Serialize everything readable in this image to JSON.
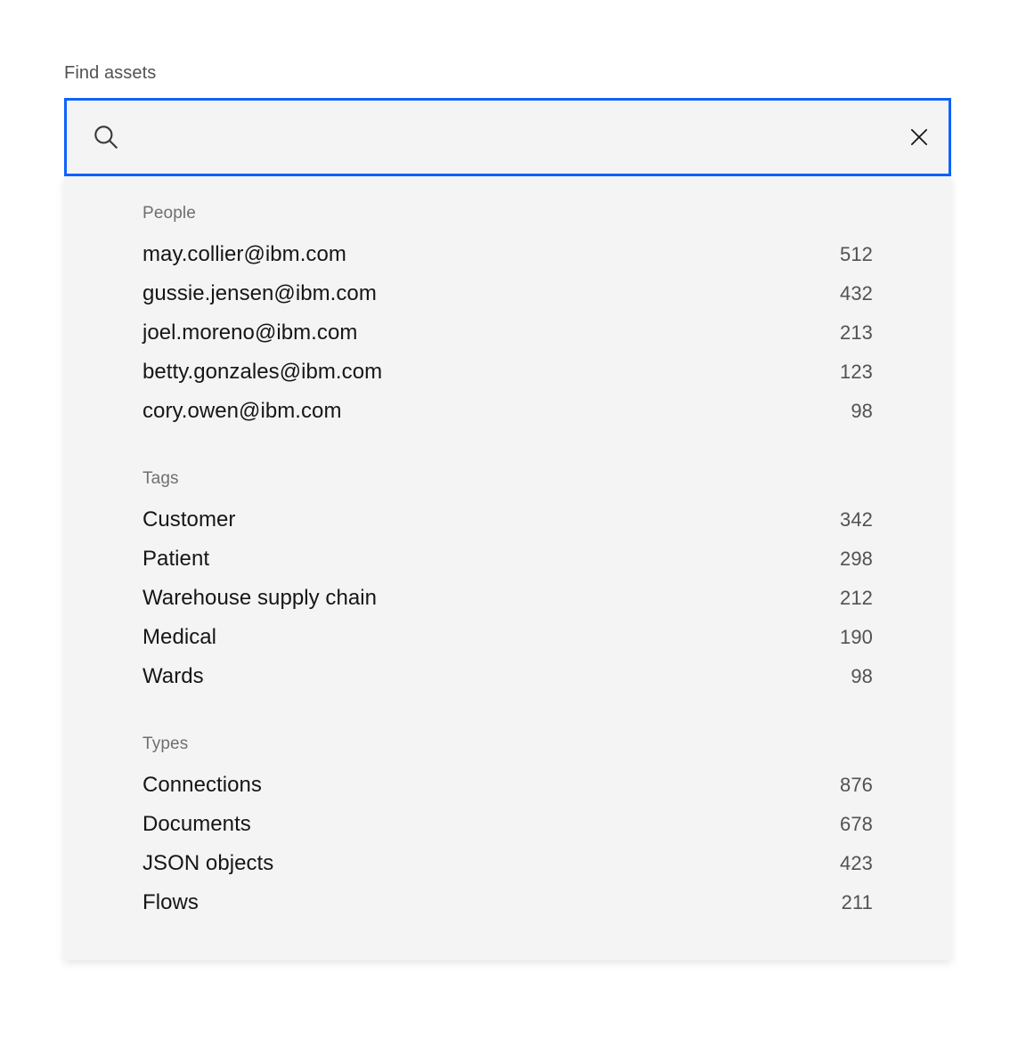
{
  "field": {
    "label": "Find assets",
    "search_icon": "search-icon",
    "clear_icon": "close-icon",
    "input_value": "",
    "input_placeholder": "",
    "focus_color": "#0f62fe",
    "field_background": "#f4f4f4"
  },
  "results": {
    "panel_background": "#f4f4f4",
    "sections": [
      {
        "title": "People",
        "items": [
          {
            "label": "may.collier@ibm.com",
            "count": "512"
          },
          {
            "label": "gussie.jensen@ibm.com",
            "count": "432"
          },
          {
            "label": "joel.moreno@ibm.com",
            "count": "213"
          },
          {
            "label": "betty.gonzales@ibm.com",
            "count": "123"
          },
          {
            "label": "cory.owen@ibm.com",
            "count": "98"
          }
        ]
      },
      {
        "title": "Tags",
        "items": [
          {
            "label": "Customer",
            "count": "342"
          },
          {
            "label": "Patient",
            "count": "298"
          },
          {
            "label": "Warehouse supply chain",
            "count": "212"
          },
          {
            "label": "Medical",
            "count": "190"
          },
          {
            "label": "Wards",
            "count": "98"
          }
        ]
      },
      {
        "title": "Types",
        "items": [
          {
            "label": "Connections",
            "count": "876"
          },
          {
            "label": "Documents",
            "count": "678"
          },
          {
            "label": "JSON objects",
            "count": "423"
          },
          {
            "label": "Flows",
            "count": "211"
          }
        ]
      }
    ]
  }
}
